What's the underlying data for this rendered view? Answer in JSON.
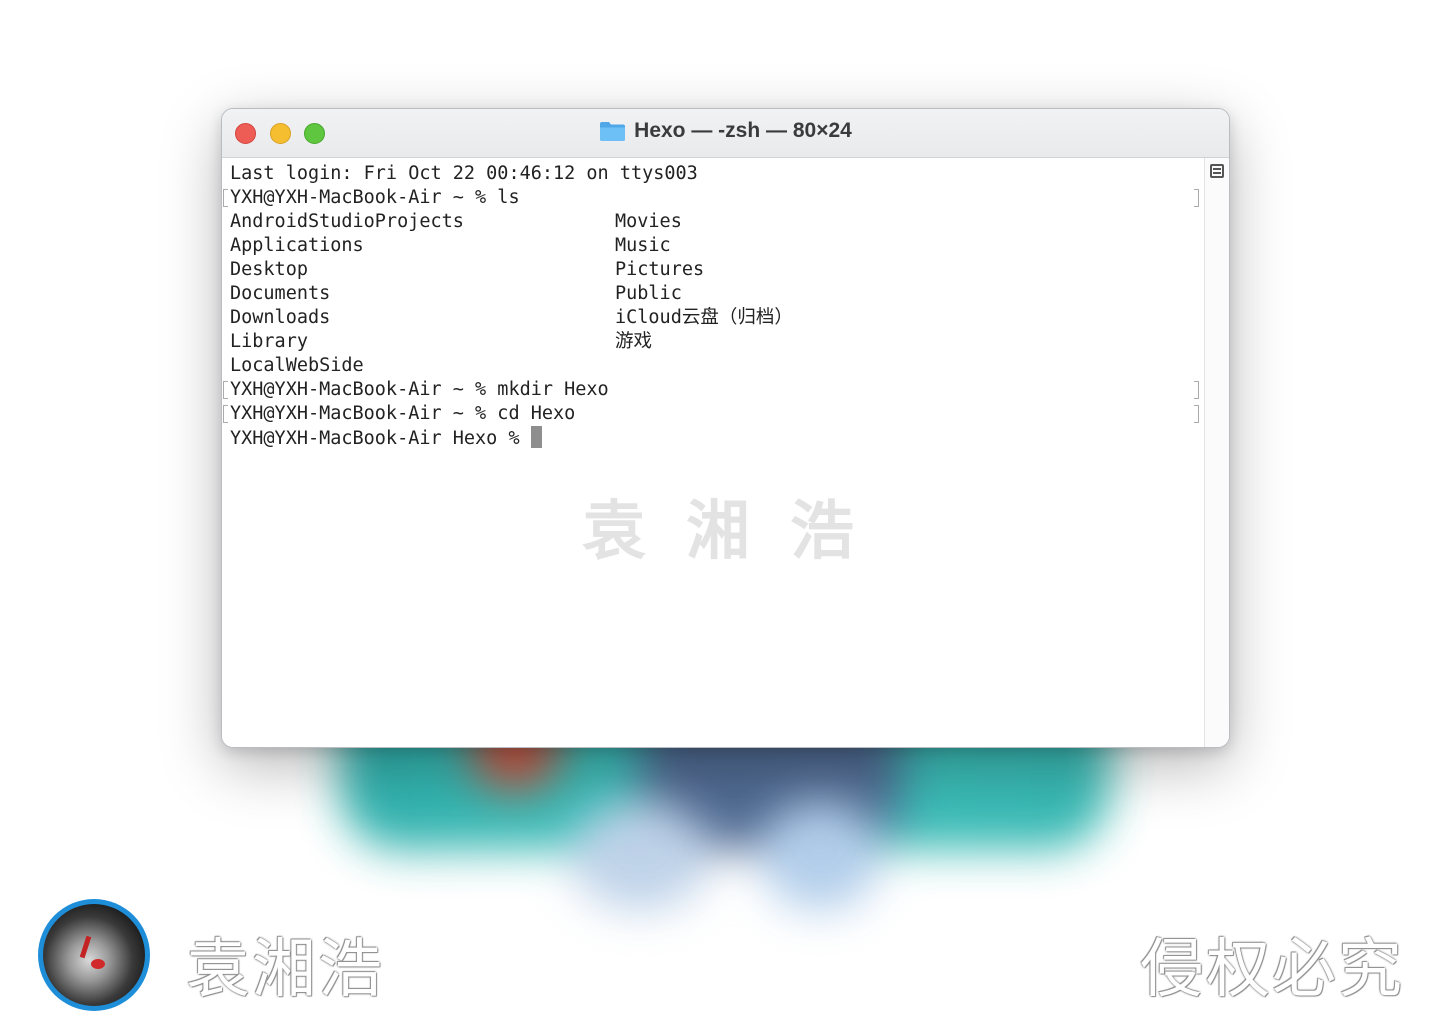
{
  "window": {
    "title": "Hexo — -zsh — 80×24",
    "folder_icon": "folder-icon",
    "traffic_lights": {
      "close": "#ed5d55",
      "minimize": "#f5bd30",
      "zoom": "#5fc63f"
    }
  },
  "terminal": {
    "last_login": "Last login: Fri Oct 22 00:46:12 on ttys003",
    "prompt_ls": "YXH@YXH-MacBook-Air ~ % ls",
    "ls_col1": [
      "AndroidStudioProjects",
      "Applications",
      "Desktop",
      "Documents",
      "Downloads",
      "Library",
      "LocalWebSide"
    ],
    "ls_col2": [
      "Movies",
      "Music",
      "Pictures",
      "Public",
      "iCloud云盘（归档）",
      "游戏"
    ],
    "prompt_mkdir": "YXH@YXH-MacBook-Air ~ % mkdir Hexo",
    "prompt_cd": "YXH@YXH-MacBook-Air ~ % cd Hexo",
    "current_prompt": "YXH@YXH-MacBook-Air Hexo % "
  },
  "watermark": {
    "center_text": "袁湘浩"
  },
  "footer": {
    "author_name": "袁湘浩",
    "copyright_notice": "侵权必究"
  }
}
